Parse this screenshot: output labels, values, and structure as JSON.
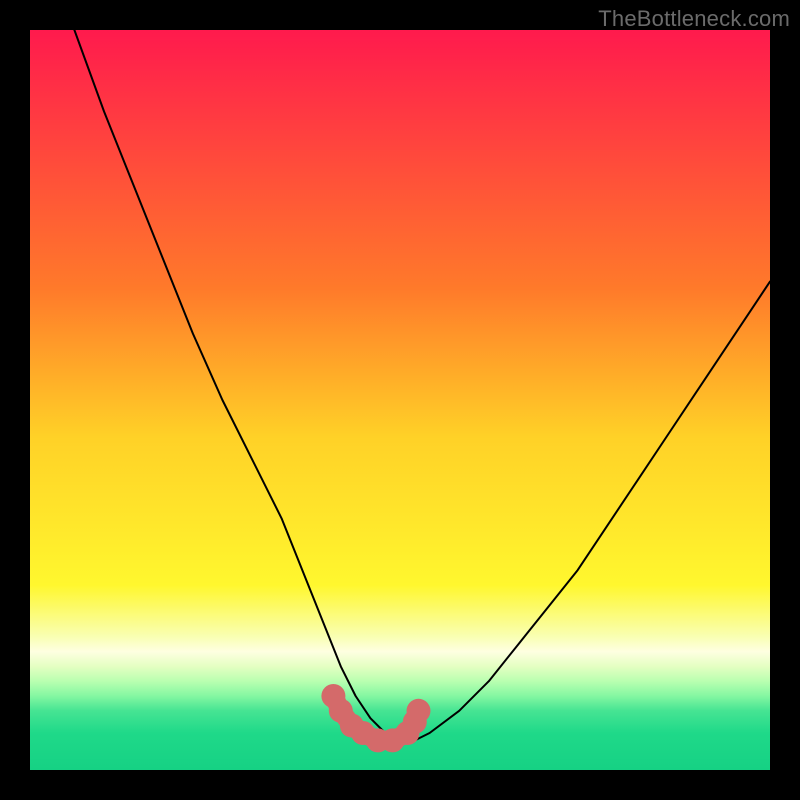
{
  "watermark": "TheBottleneck.com",
  "chart_data": {
    "type": "line",
    "title": "",
    "xlabel": "",
    "ylabel": "",
    "xlim": [
      0,
      100
    ],
    "ylim": [
      0,
      100
    ],
    "grid": false,
    "legend": false,
    "background_gradient": {
      "stops": [
        {
          "pos": 0,
          "color": "#ff1a4d"
        },
        {
          "pos": 35,
          "color": "#ff7a2a"
        },
        {
          "pos": 55,
          "color": "#ffd127"
        },
        {
          "pos": 75,
          "color": "#fff72e"
        },
        {
          "pos": 82,
          "color": "#f9ffb3"
        },
        {
          "pos": 84,
          "color": "#feffe1"
        },
        {
          "pos": 86,
          "color": "#e4ffc2"
        },
        {
          "pos": 88,
          "color": "#b9ffb0"
        },
        {
          "pos": 90,
          "color": "#84f7a2"
        },
        {
          "pos": 92,
          "color": "#46e493"
        },
        {
          "pos": 95,
          "color": "#1fd989"
        },
        {
          "pos": 100,
          "color": "#16d184"
        }
      ]
    },
    "annotations": [],
    "series": [
      {
        "name": "bottleneck-curve",
        "color": "#000000",
        "width": 2,
        "x": [
          6,
          10,
          14,
          18,
          22,
          26,
          30,
          34,
          38,
          40,
          42,
          44,
          46,
          48,
          50,
          52,
          54,
          58,
          62,
          66,
          70,
          74,
          78,
          82,
          86,
          90,
          94,
          98,
          100
        ],
        "y": [
          100,
          89,
          79,
          69,
          59,
          50,
          42,
          34,
          24,
          19,
          14,
          10,
          7,
          5,
          4,
          4,
          5,
          8,
          12,
          17,
          22,
          27,
          33,
          39,
          45,
          51,
          57,
          63,
          66
        ]
      },
      {
        "name": "optimal-band-markers",
        "type": "scatter",
        "color": "#d46a6a",
        "marker_size": 12,
        "x": [
          41,
          42,
          43.5,
          45,
          47,
          49,
          51,
          52,
          52.5
        ],
        "y": [
          10,
          8,
          6,
          5,
          4,
          4,
          5,
          6.5,
          8
        ]
      }
    ]
  }
}
